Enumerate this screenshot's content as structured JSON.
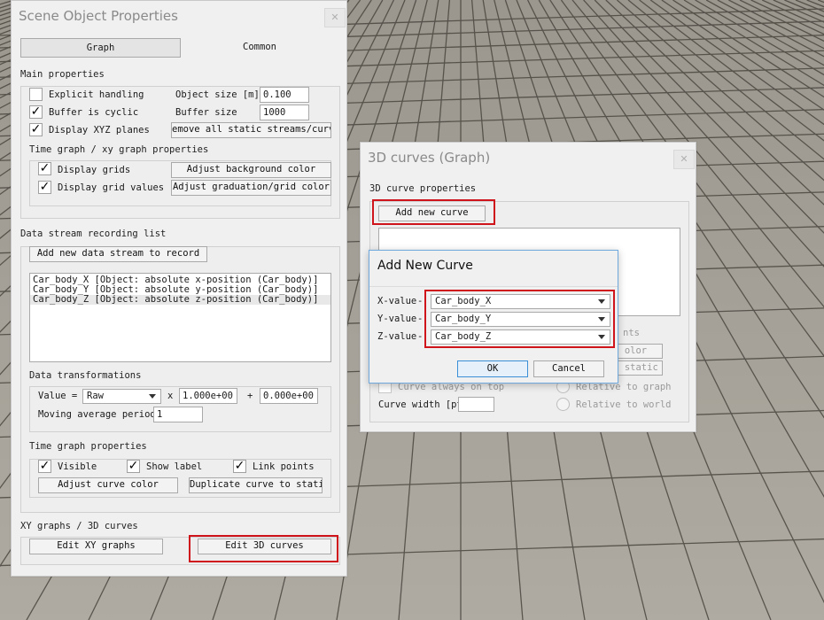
{
  "props_window": {
    "title": "Scene Object Properties",
    "close": "✕",
    "tabs": [
      "Graph",
      "Common"
    ],
    "main_properties": {
      "label": "Main properties",
      "explicit_handling": {
        "label": "Explicit handling",
        "checked": false
      },
      "buffer_cyclic": {
        "label": "Buffer is cyclic",
        "checked": true
      },
      "display_xyz": {
        "label": "Display XYZ planes",
        "checked": true
      },
      "object_size_label": "Object size [m]",
      "object_size_value": "0.100",
      "buffer_size_label": "Buffer size",
      "buffer_size_value": "1000",
      "remove_streams_button": "emove all static streams/curve"
    },
    "time_xy_graph": {
      "label": "Time graph / xy graph properties",
      "display_grids": {
        "label": "Display grids",
        "checked": true
      },
      "display_grid_values": {
        "label": "Display grid values",
        "checked": true
      },
      "adjust_bg_button": "Adjust background color",
      "adjust_grad_button": "Adjust graduation/grid color"
    },
    "data_stream": {
      "label": "Data stream recording list",
      "add_button": "Add new data stream to record",
      "items": [
        "Car_body_X [Object: absolute x-position (Car_body)]",
        "Car_body_Y [Object: absolute y-position (Car_body)]",
        "Car_body_Z [Object: absolute z-position (Car_body)]"
      ]
    },
    "transformations": {
      "label": "Data transformations",
      "value_label": "Value =",
      "value_select": "Raw",
      "times": "x",
      "mult_value": "1.000e+00",
      "plus": "+",
      "add_value": "0.000e+00",
      "moving_avg_label": "Moving average period",
      "moving_avg_value": "1"
    },
    "time_graph": {
      "label": "Time graph properties",
      "visible": {
        "label": "Visible",
        "checked": true
      },
      "show_label": {
        "label": "Show label",
        "checked": true
      },
      "link_points": {
        "label": "Link points",
        "checked": true
      },
      "adjust_curve_button": "Adjust curve color",
      "duplicate_button": "Duplicate curve to static"
    },
    "xy_3d": {
      "label": "XY graphs / 3D curves",
      "edit_xy_button": "Edit XY graphs",
      "edit_3d_button": "Edit 3D curves"
    }
  },
  "curves_window": {
    "title": "3D curves (Graph)",
    "close": "✕",
    "props_label": "3D curve properties",
    "add_button": "Add new curve",
    "partial_texts": {
      "points": "nts",
      "color": "olor",
      "static": "o static"
    },
    "always_on_top": "Curve always on top",
    "relative_graph": "Relative to graph",
    "relative_world": "Relative to world",
    "curve_width_label": "Curve width [pt"
  },
  "add_curve_dialog": {
    "title": "Add New Curve",
    "x_label": "X-value",
    "y_label": "Y-value",
    "z_label": "Z-value",
    "x_value": "Car_body_X",
    "y_value": "Car_body_Y",
    "z_value": "Car_body_Z",
    "ok": "OK",
    "cancel": "Cancel"
  },
  "colors": {
    "highlight": "#d0141c",
    "window_bg": "#f0f0f0",
    "dialog_border": "#6fa8dc"
  }
}
